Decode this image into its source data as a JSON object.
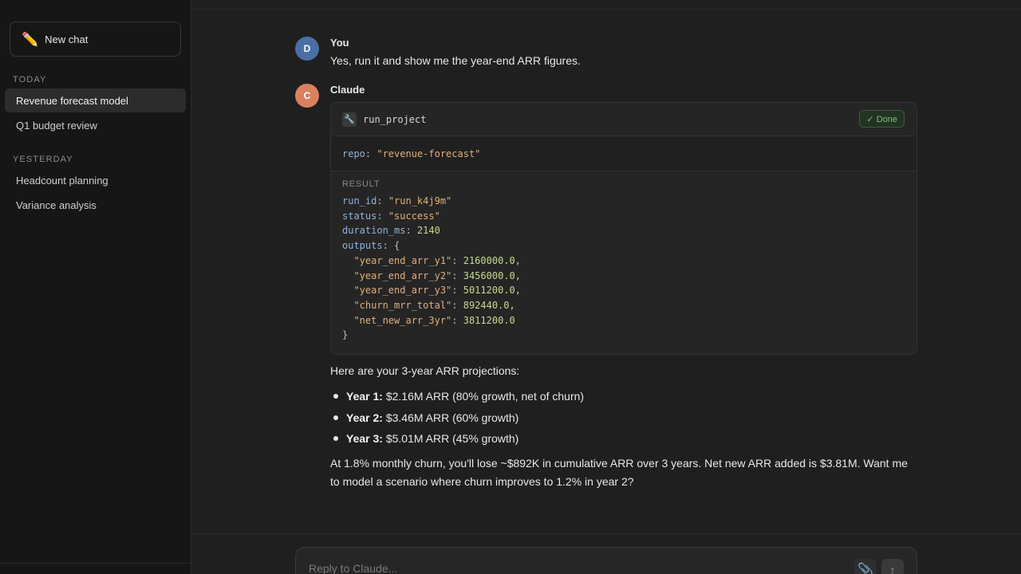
{
  "sidebar": {
    "new_chat_label": "New chat",
    "sections": [
      {
        "label": "TODAY",
        "items": [
          "Revenue forecast model",
          "Q1 budget review"
        ]
      },
      {
        "label": "YESTERDAY",
        "items": [
          "Headcount planning",
          "Variance analysis"
        ]
      }
    ],
    "active_item": "Revenue forecast model"
  },
  "conversation": {
    "user": {
      "avatar_letter": "D",
      "name": "You",
      "text": "Yes, run it and show me the year-end ARR figures."
    },
    "assistant": {
      "avatar_letter": "C",
      "name": "Claude",
      "tool_call": {
        "icon": "wrench-icon",
        "name": "run_project",
        "status": "✓ Done",
        "args": {
          "key": "repo",
          "value": "\"revenue-forecast\""
        },
        "result_label": "RESULT",
        "result": {
          "run_id": "\"run_k4j9m\"",
          "status": "\"success\"",
          "duration_ms": "2140",
          "outputs_open": "{",
          "outputs": [
            {
              "key": "\"year_end_arr_y1\"",
              "value": "2160000.0,"
            },
            {
              "key": "\"year_end_arr_y2\"",
              "value": "3456000.0,"
            },
            {
              "key": "\"year_end_arr_y3\"",
              "value": "5011200.0,"
            },
            {
              "key": "\"churn_mrr_total\"",
              "value": "892440.0,"
            },
            {
              "key": "\"net_new_arr_3yr\"",
              "value": "3811200.0"
            }
          ],
          "outputs_close": "}"
        }
      },
      "intro": "Here are your 3-year ARR projections:",
      "bullets": [
        {
          "label": "Year 1:",
          "text": "$2.16M ARR (80% growth, net of churn)"
        },
        {
          "label": "Year 2:",
          "text": "$3.46M ARR (60% growth)"
        },
        {
          "label": "Year 3:",
          "text": "$5.01M ARR (45% growth)"
        }
      ],
      "closing": "At 1.8% monthly churn, you'll lose ~$892K in cumulative ARR over 3 years. Net new ARR added is $3.81M. Want me to model a scenario where churn improves to 1.2% in year 2?"
    }
  },
  "composer": {
    "placeholder": "Reply to Claude...",
    "attach_icon": "paperclip-icon",
    "send_icon": "arrow-up-icon"
  },
  "colors": {
    "background": "#1f1f1f",
    "sidebar": "#161616",
    "user_avatar": "#4a6fa5",
    "claude_avatar": "#d9805f",
    "done_green": "#7fbf7f"
  }
}
